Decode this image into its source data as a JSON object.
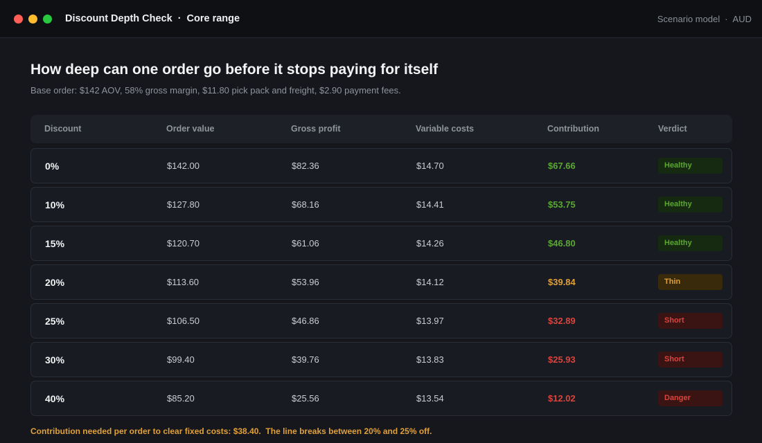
{
  "window": {
    "title": "Discount Depth Check",
    "separator": "·",
    "range": "Core range",
    "mode": "Scenario model",
    "mode_separator": "·",
    "currency": "AUD"
  },
  "heading": "How deep can one order go before it stops paying for itself",
  "description": "Base order: $142 AOV, 58% gross margin, $11.80 pick pack and freight, $2.90 payment fees.",
  "columns": [
    "Discount",
    "Order value",
    "Gross profit",
    "Variable costs",
    "Contribution",
    "Verdict"
  ],
  "rows": [
    {
      "discount": "0%",
      "order_value": "$142.00",
      "gross_profit": "$82.36",
      "variable_costs": "$14.70",
      "contribution": "$67.66",
      "verdict": "Healthy",
      "status": "healthy"
    },
    {
      "discount": "10%",
      "order_value": "$127.80",
      "gross_profit": "$68.16",
      "variable_costs": "$14.41",
      "contribution": "$53.75",
      "verdict": "Healthy",
      "status": "healthy"
    },
    {
      "discount": "15%",
      "order_value": "$120.70",
      "gross_profit": "$61.06",
      "variable_costs": "$14.26",
      "contribution": "$46.80",
      "verdict": "Healthy",
      "status": "healthy"
    },
    {
      "discount": "20%",
      "order_value": "$113.60",
      "gross_profit": "$53.96",
      "variable_costs": "$14.12",
      "contribution": "$39.84",
      "verdict": "Thin",
      "status": "thin"
    },
    {
      "discount": "25%",
      "order_value": "$106.50",
      "gross_profit": "$46.86",
      "variable_costs": "$13.97",
      "contribution": "$32.89",
      "verdict": "Short",
      "status": "short"
    },
    {
      "discount": "30%",
      "order_value": "$99.40",
      "gross_profit": "$39.76",
      "variable_costs": "$13.83",
      "contribution": "$25.93",
      "verdict": "Short",
      "status": "short"
    },
    {
      "discount": "40%",
      "order_value": "$85.20",
      "gross_profit": "$25.56",
      "variable_costs": "$13.54",
      "contribution": "$12.02",
      "verdict": "Danger",
      "status": "danger"
    }
  ],
  "status_colors": {
    "healthy": {
      "text": "#5aa832",
      "badge_bg": "#152a10",
      "badge_text": "#5aa832"
    },
    "thin": {
      "text": "#e0a03a",
      "badge_bg": "#3a2a0c",
      "badge_text": "#e0a03a"
    },
    "short": {
      "text": "#d9443e",
      "badge_bg": "#3a1413",
      "badge_text": "#d9443e"
    },
    "danger": {
      "text": "#d9443e",
      "badge_bg": "#3a1413",
      "badge_text": "#d9443e"
    }
  },
  "footer": "Contribution needed per order to clear fixed costs: $38.40.  The line breaks between 20% and 25% off."
}
